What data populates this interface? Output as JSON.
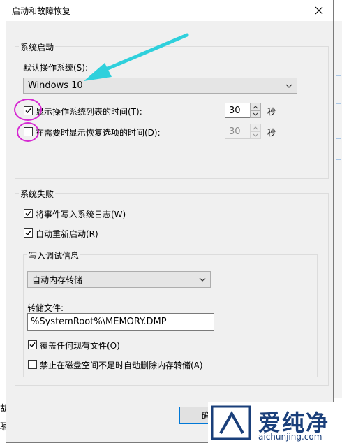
{
  "background": {
    "left_texts": [
      "胡",
      "骊"
    ]
  },
  "dialog": {
    "title": "启动和故障恢复",
    "system_startup": {
      "legend": "系统启动",
      "default_os_label": "默认操作系统(S):",
      "default_os_value": "Windows 10",
      "show_os_list": {
        "label": "显示操作系统列表的时间(T):",
        "checked": true,
        "value": "30",
        "unit": "秒"
      },
      "show_recovery": {
        "label": "在需要时显示恢复选项的时间(D):",
        "checked": false,
        "value": "30",
        "unit": "秒"
      }
    },
    "system_failure": {
      "legend": "系统失败",
      "write_event_log": {
        "label": "将事件写入系统日志(W)",
        "checked": true
      },
      "auto_restart": {
        "label": "自动重新启动(R)",
        "checked": true
      },
      "debug_info": {
        "legend": "写入调试信息",
        "dump_type_value": "自动内存转储",
        "dump_file_label": "转储文件:",
        "dump_file_value": "%SystemRoot%\\MEMORY.DMP",
        "overwrite": {
          "label": "覆盖任何现有文件(O)",
          "checked": true
        },
        "disable_auto_delete": {
          "label": "禁止在磁盘空间不足时自动删除内存转储(A)",
          "checked": false
        }
      }
    },
    "ok_button_label": "确"
  },
  "watermark": {
    "brand": "爱纯净",
    "url": "aichunjing.com"
  },
  "colors": {
    "annotation_arrow": "#2fd0dc",
    "annotation_circle": "#d62ad2",
    "focus_border": "#0078d7"
  }
}
